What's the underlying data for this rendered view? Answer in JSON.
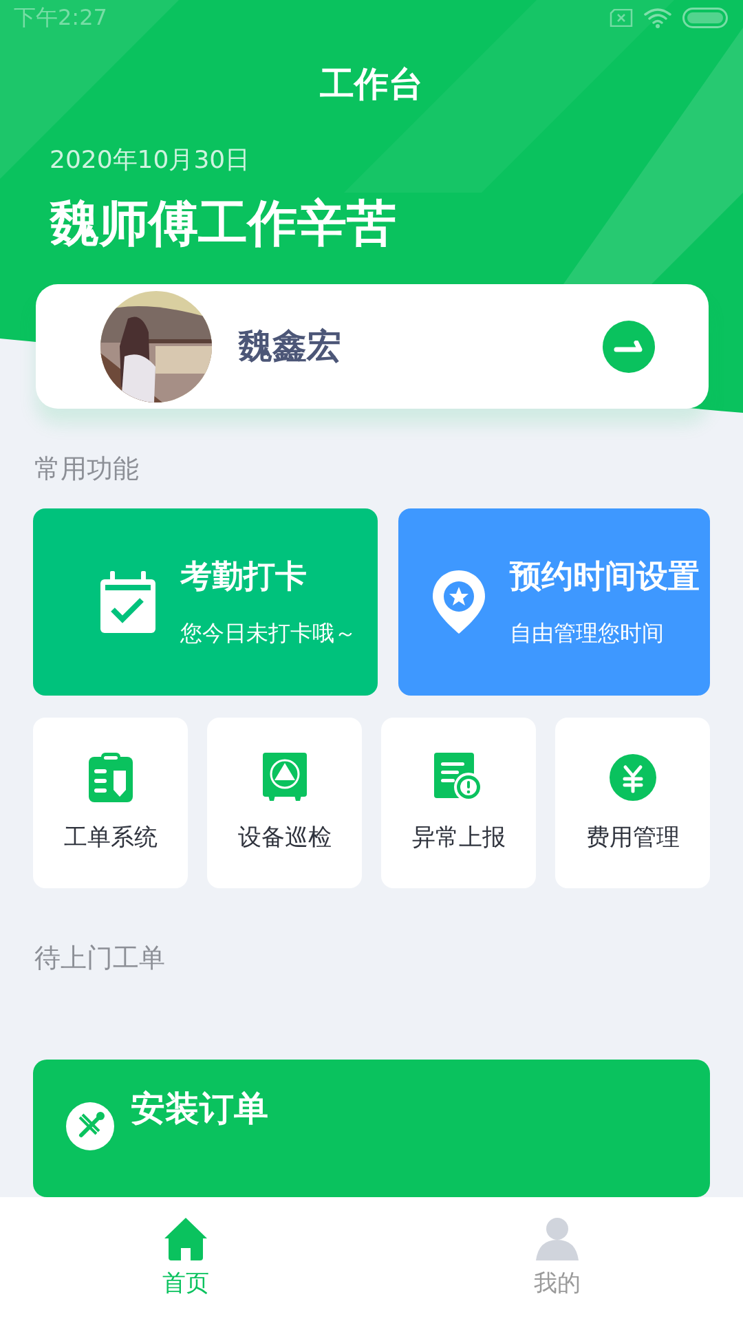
{
  "status_bar": {
    "time": "下午2:27"
  },
  "header": {
    "title": "工作台",
    "date": "2020年10月30日",
    "greeting": "魏师傅工作辛苦"
  },
  "profile": {
    "name": "魏鑫宏"
  },
  "common_section": {
    "title": "常用功能"
  },
  "features": [
    {
      "kind": "attendance",
      "title": "考勤打卡",
      "subtitle": "您今日未打卡哦～",
      "color": "#00c27c"
    },
    {
      "kind": "schedule",
      "title": "预约时间设置",
      "subtitle": "自由管理您时间",
      "color": "#3e98ff"
    }
  ],
  "tiles": [
    {
      "kind": "workorder",
      "label": "工单系统"
    },
    {
      "kind": "inspection",
      "label": "设备巡检"
    },
    {
      "kind": "exception",
      "label": "异常上报"
    },
    {
      "kind": "expense",
      "label": "费用管理"
    }
  ],
  "pending_section": {
    "title": "待上门工单"
  },
  "pending_orders": [
    {
      "title": "安装订单"
    }
  ],
  "tab_bar": [
    {
      "kind": "home",
      "label": "首页",
      "selected": true
    },
    {
      "kind": "profile",
      "label": "我的",
      "selected": false
    }
  ]
}
